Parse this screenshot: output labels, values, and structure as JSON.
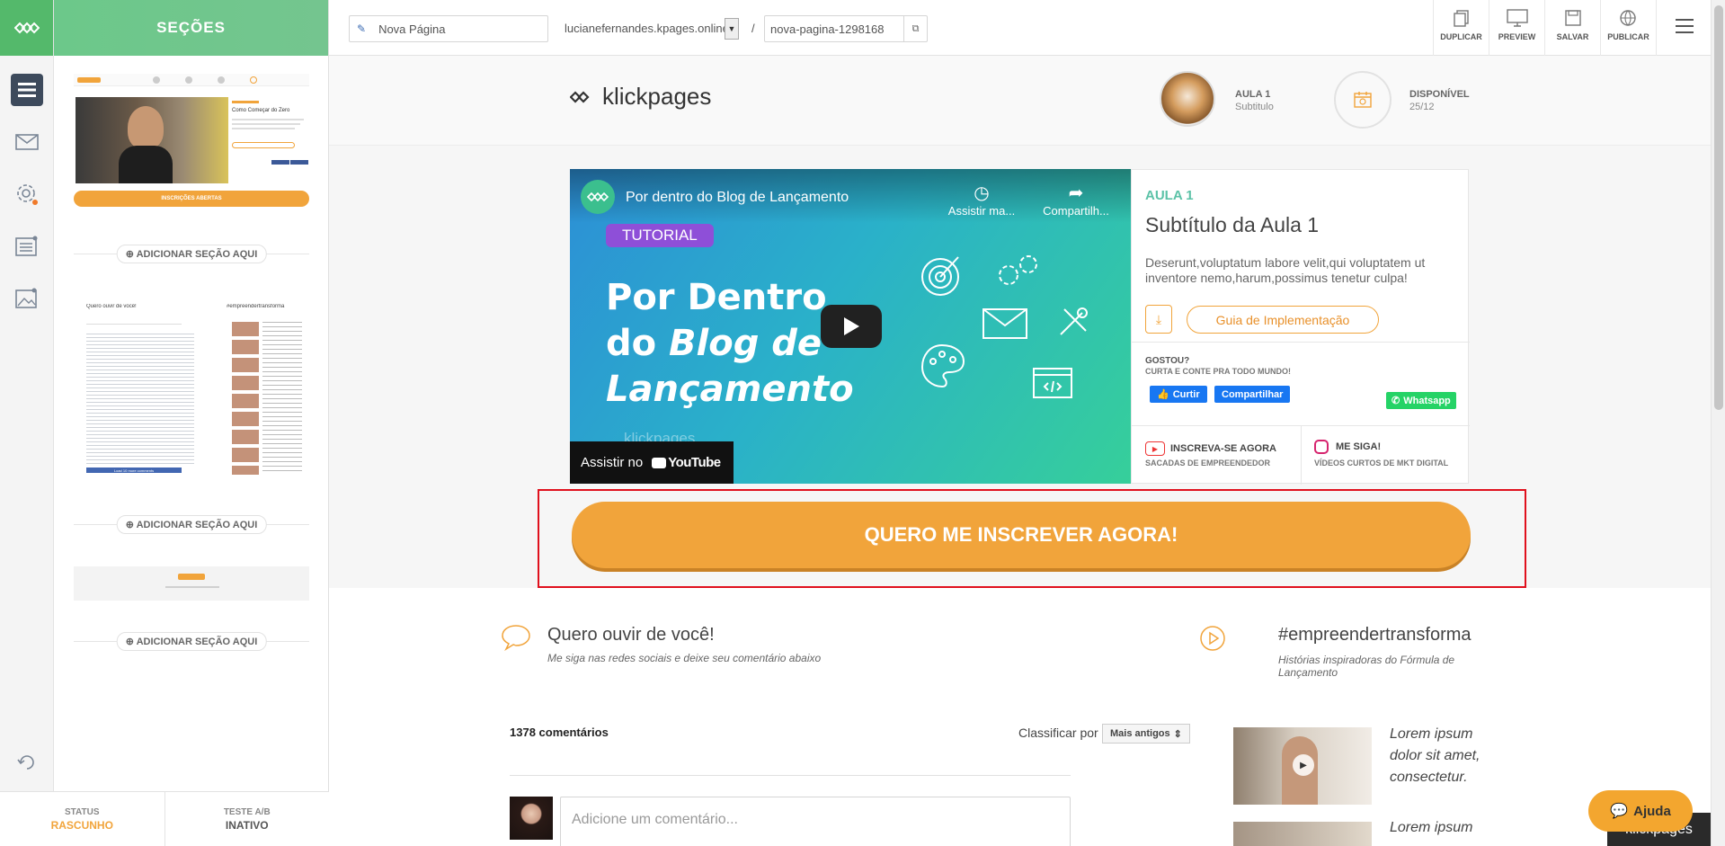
{
  "sidebar": {
    "title": "SEÇÕES",
    "add_section_label": "ADICIONAR SEÇÃO AQUI",
    "thumb1_cta": "INSCRIÇÕES ABERTAS",
    "thumb1_title": "Como Começar do Zero",
    "thumb2_left_title": "Quero ouvir de você!",
    "thumb2_right_title": "#empreendertransforma",
    "thumb2_load_more": "Load 10 more comments"
  },
  "status": {
    "status_label": "STATUS",
    "status_value": "RASCUNHO",
    "ab_label": "TESTE A/B",
    "ab_value": "INATIVO"
  },
  "toolbar": {
    "page_name": "Nova Página",
    "domain": "lucianefernandes.kpages.online",
    "slash": "/",
    "slug": "nova-pagina-1298168",
    "duplicate_label": "DUPLICAR",
    "preview_label": "PREVIEW",
    "save_label": "SALVAR",
    "publish_label": "PUBLICAR"
  },
  "hero": {
    "brand": "klickpages",
    "lesson_label": "AULA 1",
    "lesson_sub": "Subtitulo",
    "available_label": "DISPONÍVEL",
    "available_date": "25/12"
  },
  "video": {
    "title": "Por dentro do Blog de Lançamento",
    "watch_later": "Assistir ma...",
    "share": "Compartilh...",
    "tag": "TUTORIAL",
    "headline_1": "Por Dentro",
    "headline_2_a": "do ",
    "headline_2_b": "Blog de",
    "headline_3": "Lançamento",
    "watermark": "klickpages",
    "watch_on": "Assistir no",
    "youtube": "YouTube"
  },
  "info": {
    "aula": "AULA 1",
    "subtitle": "Subtítulo da Aula 1",
    "description": "Deserunt,voluptatum labore velit,qui voluptatem ut inventore nemo,harum,possimus tenetur culpa!",
    "guide_button": "Guia de Implementação",
    "liked_title": "GOSTOU?",
    "liked_sub": "CURTA E CONTE PRA TODO MUNDO!",
    "fb_like": "Curtir",
    "fb_share": "Compartilhar",
    "whatsapp": "Whatsapp",
    "subscribe_title": "INSCREVA-SE AGORA",
    "subscribe_sub": "SACADAS DE EMPREENDEDOR",
    "follow_title": "ME SIGA!",
    "follow_sub": "VÍDEOS CURTOS DE MKT DIGITAL"
  },
  "cta": {
    "label": "QUERO ME INSCREVER AGORA!"
  },
  "comments": {
    "title": "Quero ouvir de você!",
    "subtitle": "Me siga nas redes sociais e deixe seu comentário abaixo",
    "count": "1378 comentários",
    "sort_label": "Classificar por",
    "sort_value": "Mais antigos",
    "placeholder": "Adicione um comentário..."
  },
  "stories": {
    "title": "#empreendertransforma",
    "subtitle": "Histórias inspiradoras do Fórmula de Lançamento",
    "item1": "Lorem ipsum dolor sit amet, consectetur.",
    "item2": "Lorem ipsum"
  },
  "help": {
    "label": "Ajuda",
    "brand": "klickpages"
  },
  "colors": {
    "accent": "#f1a43b",
    "green": "#54b96b",
    "teal": "#5bc2a7",
    "red_outline": "#e0101d"
  }
}
